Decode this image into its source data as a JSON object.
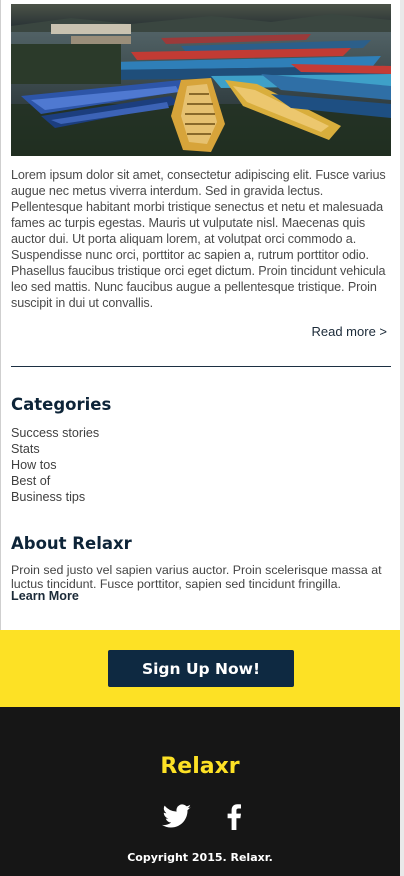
{
  "hero": {
    "image_alt": "Colorful wooden boats on a lake"
  },
  "article": {
    "body": "Lorem ipsum dolor sit amet, consectetur adipiscing elit. Fusce varius augue nec metus viverra interdum. Sed in gravida lectus. Pellentesque habitant morbi tristique senectus et netu et malesuada fames ac turpis egestas. Mauris ut vulputate nisl. Maecenas quis auctor dui. Ut porta aliquam lorem, at volutpat orci commodo a. Suspendisse nunc orci, porttitor ac sapien a, rutrum porttitor odio. Phasellus faucibus tristique orci eget dictum. Proin tincidunt vehicula leo sed mattis. Nunc faucibus augue a pellentesque tristique. Proin suscipit in dui ut convallis.",
    "read_more": "Read more >"
  },
  "categories": {
    "title": "Categories",
    "items": [
      "Success stories",
      "Stats",
      "How tos",
      "Best of",
      "Business tips"
    ]
  },
  "about": {
    "title": "About Relaxr",
    "text": "Proin sed justo vel sapien varius auctor. Proin scelerisque massa at luctus tincidunt. Fusce porttitor, sapien sed tincidunt fringilla.",
    "learn_more": "Learn More"
  },
  "cta": {
    "label": "Sign Up Now!"
  },
  "footer": {
    "brand": "Relaxr",
    "social": [
      {
        "icon": "twitter-bird-icon"
      },
      {
        "icon": "facebook-f-icon"
      }
    ],
    "copyright": "Copyright 2015. Relaxr."
  },
  "colors": {
    "accent_yellow": "#fde125",
    "navy": "#0e2941",
    "footer_bg": "#161616"
  }
}
